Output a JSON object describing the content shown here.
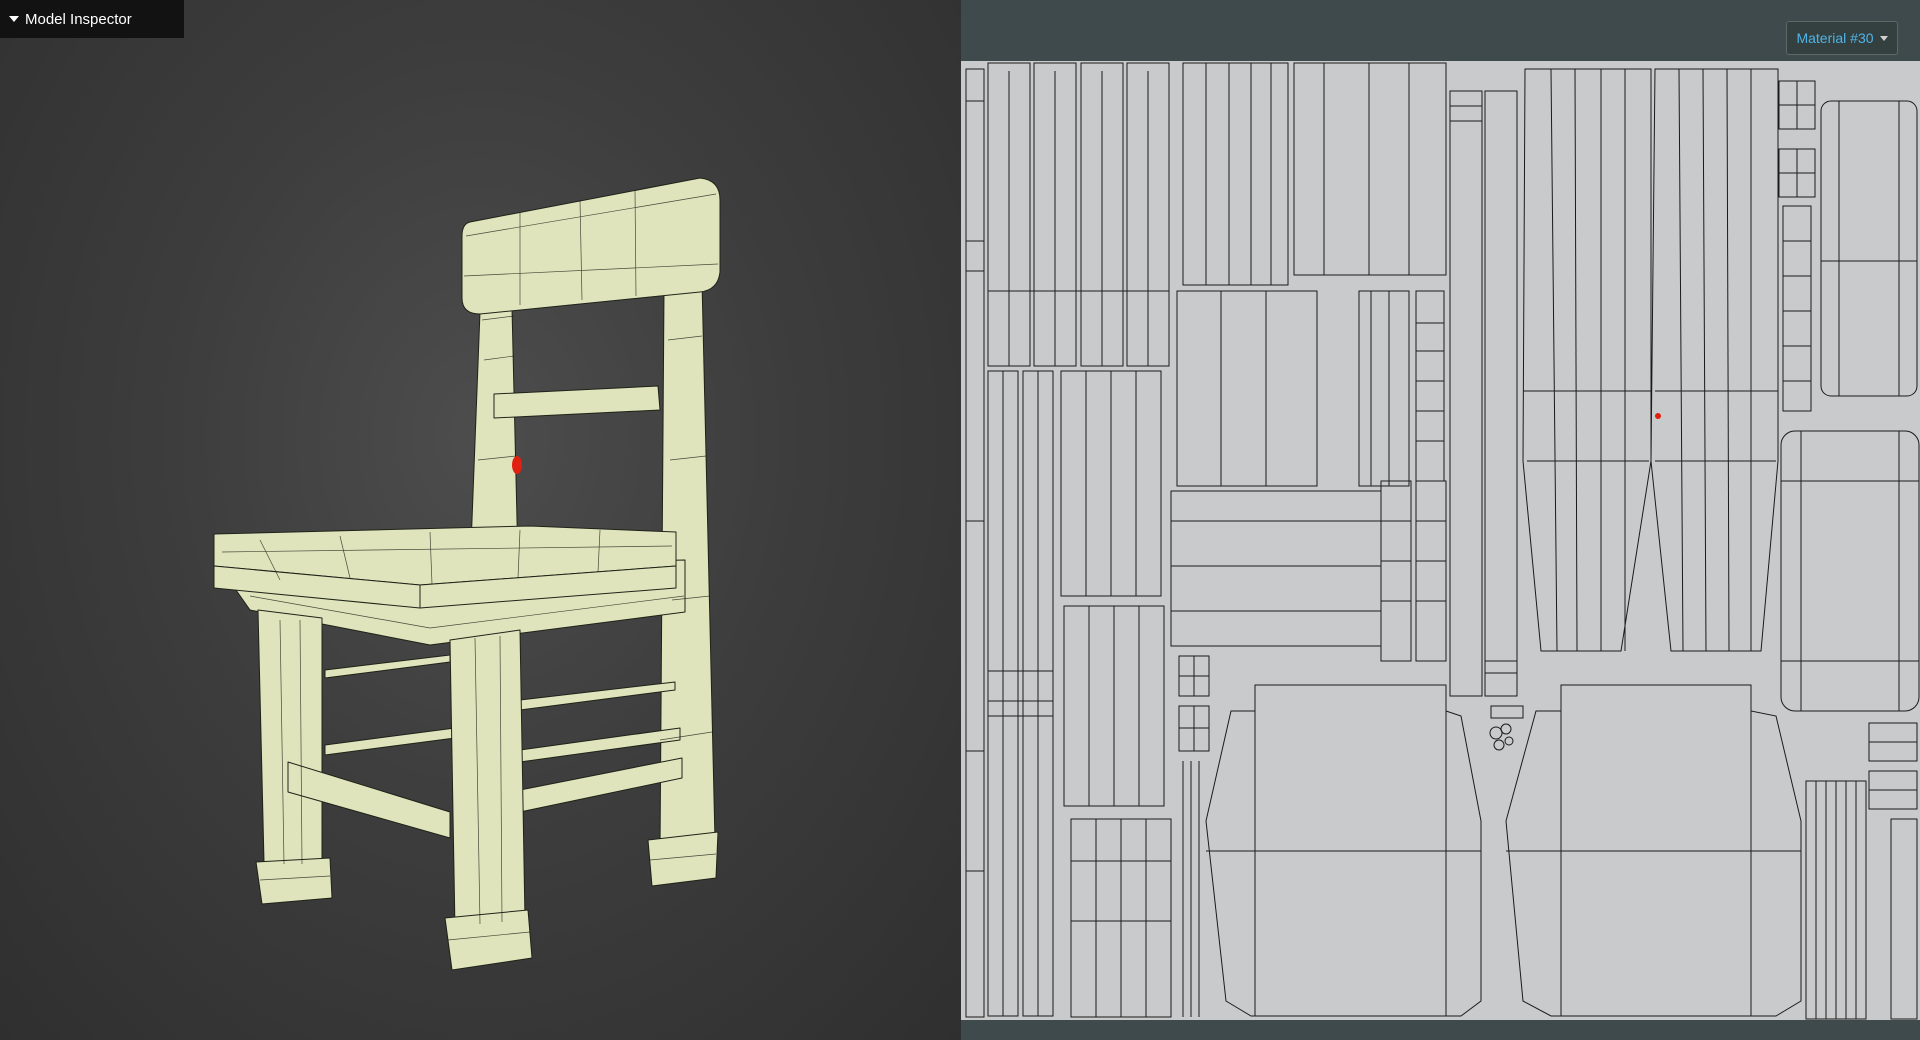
{
  "inspector": {
    "title": "Model Inspector",
    "expanded": true,
    "icon": "caret-down-icon"
  },
  "material_selector": {
    "label": "Material #30",
    "icon": "chevron-down-icon"
  },
  "colors": {
    "viewport_bg": "#3d3d3d",
    "model_fill": "#dfe4bc",
    "wire": "#1f2318",
    "uv_sheet": "#c9cacb",
    "uv_panel_bg": "#3e4a4b",
    "uv_lines": "#1b1b1b",
    "accent": "#4fb3e8",
    "marker": "#e02010"
  }
}
